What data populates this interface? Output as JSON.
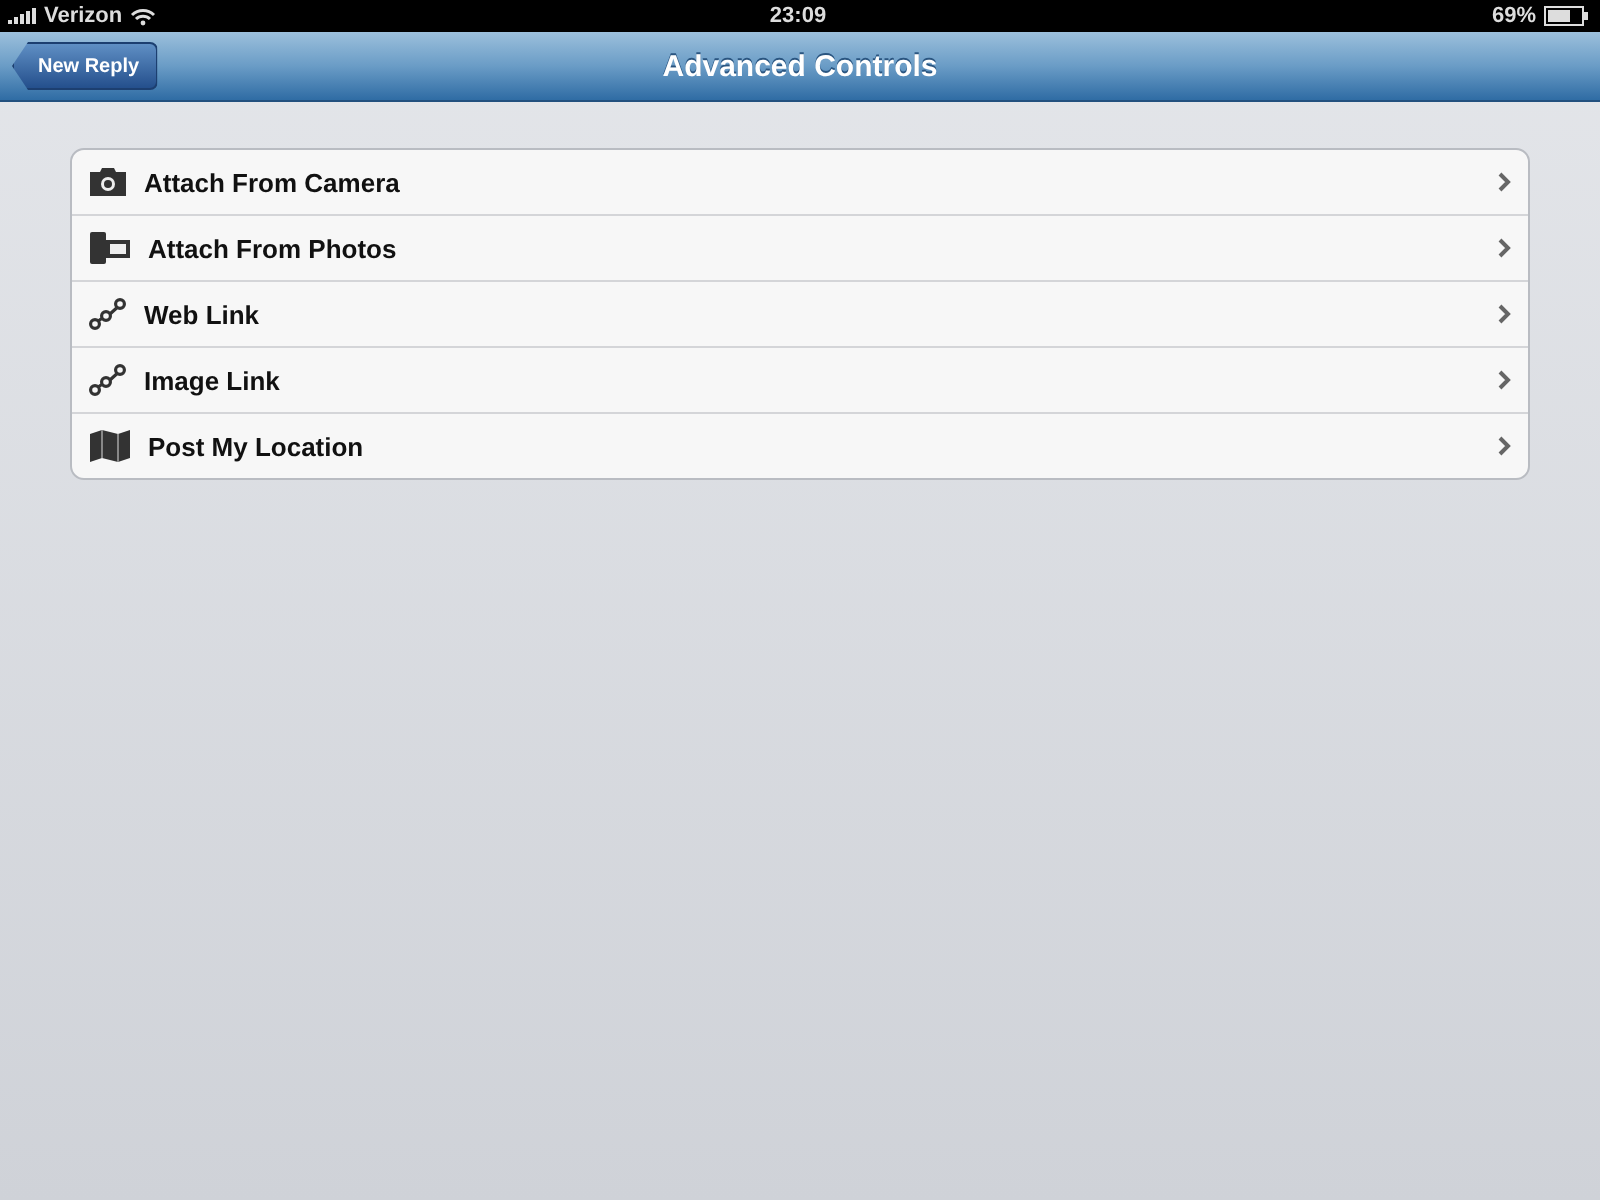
{
  "status_bar": {
    "carrier": "Verizon",
    "time": "23:09",
    "battery": "69%"
  },
  "nav_bar": {
    "title": "Advanced Controls",
    "back_button": "New Reply"
  },
  "items": [
    {
      "label": "Attach From Camera",
      "kind": "camera"
    },
    {
      "label": "Attach From Photos",
      "kind": "film"
    },
    {
      "label": "Web Link",
      "kind": "link"
    },
    {
      "label": "Image Link",
      "kind": "link"
    },
    {
      "label": "Post My Location",
      "kind": "map"
    }
  ]
}
